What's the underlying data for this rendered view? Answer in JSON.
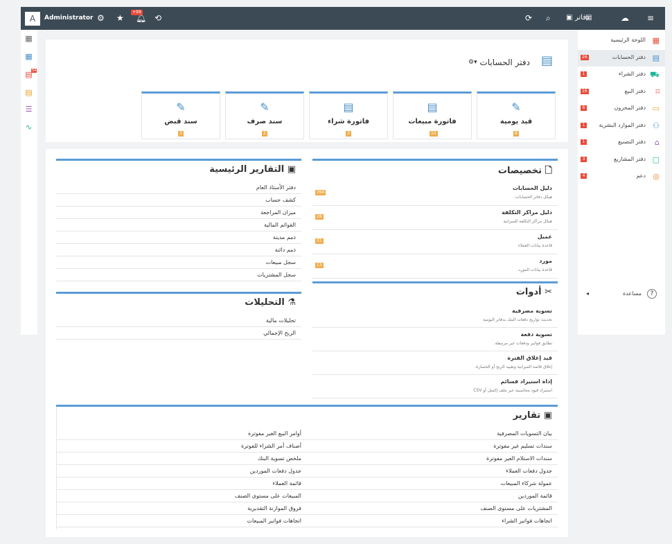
{
  "topbar": {
    "avatar": "A",
    "user": "Administrator",
    "notif_badge": "+99",
    "brand": "دفاتر"
  },
  "left_badge": "54",
  "sidebar": [
    {
      "label": "اللوحة الرئيسية",
      "icon": "dashboard-icon",
      "badge": "",
      "active": false
    },
    {
      "label": "دفتر الحسابات",
      "icon": "accounts-icon",
      "badge": "26",
      "active": true
    },
    {
      "label": "دفتر الشراء",
      "icon": "cart-icon",
      "badge": "1",
      "active": false
    },
    {
      "label": "دفتر البيع",
      "icon": "tag-icon",
      "badge": "16",
      "active": false
    },
    {
      "label": "دفتر المخزون",
      "icon": "box-icon",
      "badge": "6",
      "active": false
    },
    {
      "label": "دفتر الموارد البشرية",
      "icon": "people-icon",
      "badge": "1",
      "active": false
    },
    {
      "label": "دفتر التصنيع",
      "icon": "factory-icon",
      "badge": "1",
      "active": false
    },
    {
      "label": "دفتر المشاريع",
      "icon": "briefcase-icon",
      "badge": "3",
      "active": false
    },
    {
      "label": "دعم",
      "icon": "lifebuoy-icon",
      "badge": "4",
      "active": false
    }
  ],
  "help": "مساعدة",
  "page_title": "دفتر الحسابات",
  "cards": [
    {
      "label": "قيد يومية",
      "badge": "8"
    },
    {
      "label": "فاتورة مبيعات",
      "badge": "15"
    },
    {
      "label": "فاتورة شراء",
      "badge": "3"
    },
    {
      "label": "سند صرف",
      "badge": "2"
    },
    {
      "label": "سند قبض",
      "badge": "3"
    }
  ],
  "tasks": {
    "title": "تخصيصات",
    "items": [
      {
        "title": "دليل الحسابات",
        "sub": "هيكل دفاتر الحسابات.",
        "badge": "394"
      },
      {
        "title": "دليل مراكز التكلفة",
        "sub": "هيكل مراكز التكلفة للميزانية",
        "badge": "28"
      },
      {
        "title": "عميل",
        "sub": "قاعدة بيانات العملاء",
        "badge": "31"
      },
      {
        "title": "مورد",
        "sub": "قاعدة بيانات المورد.",
        "badge": "13"
      }
    ]
  },
  "tools": {
    "title": "أدوات",
    "items": [
      {
        "title": "تسوية مصرفية",
        "sub": "تحديث تواريخ دفعات البنك بدفاتر اليومية"
      },
      {
        "title": "تسوية دفعة",
        "sub": "تطابق فواتير ودفعات غير مرتبطة"
      },
      {
        "title": "قيد إغلاق الفترة",
        "sub": "إغلاق قائمة الميزانية وتقييد الربح أو الخسارة."
      },
      {
        "title": "إداة استيراد قسائم",
        "sub": "استيراد قيود محاسبية عبر ملف إكسل أو CSV"
      }
    ]
  },
  "main_reports": {
    "title": "التقارير الرئيسية",
    "items": [
      "دفتر الأستاذ العام",
      "كشف حساب",
      "ميزان المراجعة",
      "القوائم المالية",
      "ذمم مدينة",
      "ذمم دائنة",
      "سجل مبيعات",
      "سجل المشتريات"
    ]
  },
  "analytics": {
    "title": "التحليلات",
    "items": [
      "تحليلات مالية",
      "الربح الإجمالي"
    ]
  },
  "reports": {
    "title": "تقارير",
    "right": [
      "بيان التسويات المصرفية",
      "سندات تسليم غير مفوترة",
      "سندات الاستلام الغير مفوترة",
      "جدول دفعات العملاء",
      "عمولة شركاء المبيعات",
      "قائمة الموردين",
      "المشتريات على مستوى الصنف",
      "اتجاهات فواتير الشراء"
    ],
    "left": [
      "أوامر البيع الغير مفوترة",
      "أصناف أمر الشراء للفوترة",
      "ملخص تسوية البنك",
      "جدول دفعات الموردين",
      "قائمة العملاء",
      "المبيعات على مستوى الصنف",
      "فروق الموازنة التقديرية",
      "اتجاهات فواتير المبيعات"
    ]
  }
}
